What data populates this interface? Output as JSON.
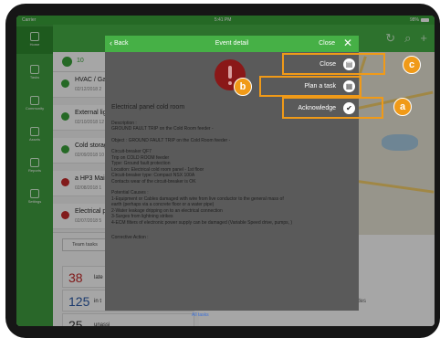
{
  "status_bar": {
    "carrier": "Carrier",
    "time": "5:41 PM",
    "battery": "98%"
  },
  "sidebar": {
    "items": [
      {
        "label": "Home"
      },
      {
        "label": "Tasks"
      },
      {
        "label": "Community"
      },
      {
        "label": "Assets"
      },
      {
        "label": "Reports"
      },
      {
        "label": "Settings"
      }
    ]
  },
  "filter": {
    "count": "10"
  },
  "alarms": [
    {
      "title": "HVAC / Gas S",
      "meta": "02/12/2018 2",
      "status": "green"
    },
    {
      "title": "External light",
      "meta": "02/10/2018 12",
      "status": "green"
    },
    {
      "title": "Cold storage",
      "meta": "02/09/2018 10",
      "status": "green"
    },
    {
      "title": "a HP3 Main",
      "meta": "02/08/2018 1",
      "status": "red"
    },
    {
      "title": "Electrical pa",
      "meta": "02/07/2018 5",
      "status": "red"
    }
  ],
  "team": {
    "tab_label": "Team tasks",
    "rows": [
      {
        "value": "38",
        "label": "late",
        "color": "#c62828"
      },
      {
        "value": "125",
        "label": "in t",
        "color": "#2a5aa8"
      },
      {
        "value": "25",
        "label": "unassi",
        "color": "#333333"
      }
    ],
    "all_tasks": "All tasks"
  },
  "map_card": {
    "text": "ndes"
  },
  "modal": {
    "back": "Back",
    "title": "Event detail",
    "close": "Close",
    "event_name": "Electrical panel cold room",
    "description": [
      "Description :",
      "GROUND FAULT TRIP on the Cold Room feeder -",
      "Object : GROUND FAULT TRIP on the Cold Room feeder -",
      "Circuit-breaker QF7",
      "Trip on COLD ROOM feeder",
      "Type: Ground fault protection",
      "Location: Electrical cold room panel - 1st floor",
      "Circuit-breaker type: Compact NSX 100A",
      "Contacts wear of the circuit-breaker is OK",
      "Potential Causes :",
      "1-Equipment or Cables damaged with wire from live conductor to the general mass of",
      "earth (perhaps via a concrete floor or a water pipe)",
      "2-Water leakage dripping on to an electrical connection",
      "3-Surges from lightning strikes",
      "4-ECM filters of electronic power supply can be damaged (Variable Speed drive, pumps, )"
    ],
    "footer": "Corrective Action :"
  },
  "actions": {
    "close": "Close",
    "plan": "Plan a task",
    "acknowledge": "Acknowledge"
  },
  "callouts": {
    "a": "a",
    "b": "b",
    "c": "c"
  }
}
